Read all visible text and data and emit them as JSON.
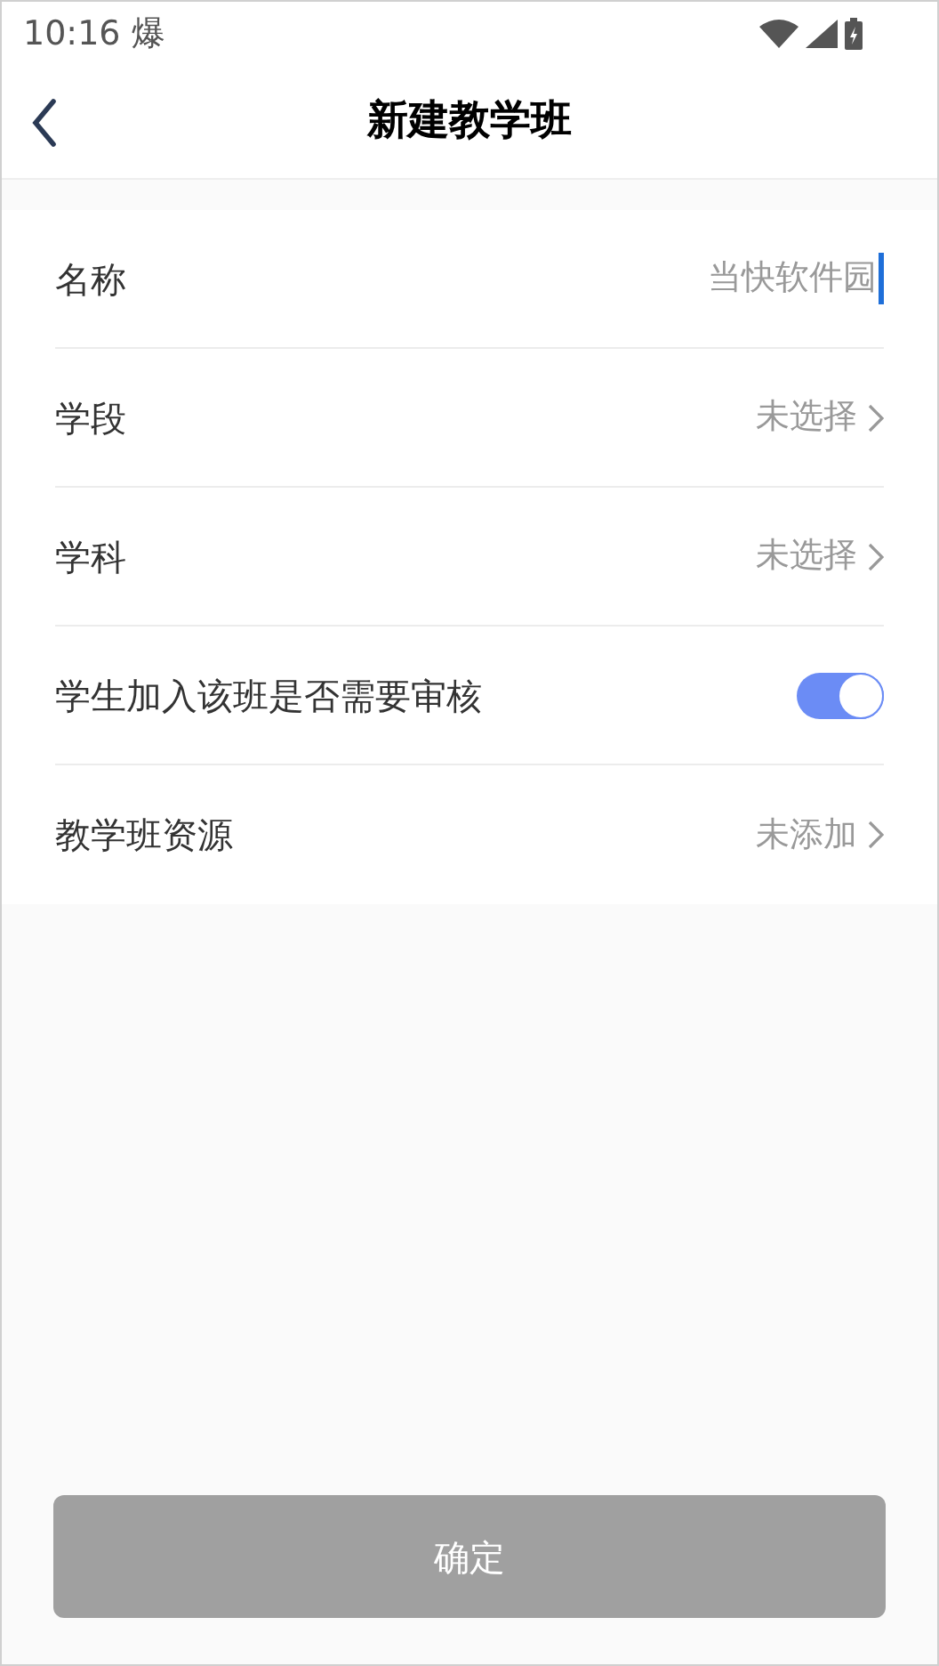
{
  "status_bar": {
    "time": "10:16",
    "notification": "爆"
  },
  "header": {
    "title": "新建教学班"
  },
  "rows": [
    {
      "kind": "input",
      "label": "名称",
      "value": "当快软件园"
    },
    {
      "kind": "select",
      "label": "学段",
      "value": "未选择"
    },
    {
      "kind": "select",
      "label": "学科",
      "value": "未选择"
    },
    {
      "kind": "toggle",
      "label": "学生加入该班是否需要审核",
      "on": true
    },
    {
      "kind": "select",
      "label": "教学班资源",
      "value": "未添加"
    }
  ],
  "confirm_button": {
    "label": "确定",
    "disabled": true
  }
}
